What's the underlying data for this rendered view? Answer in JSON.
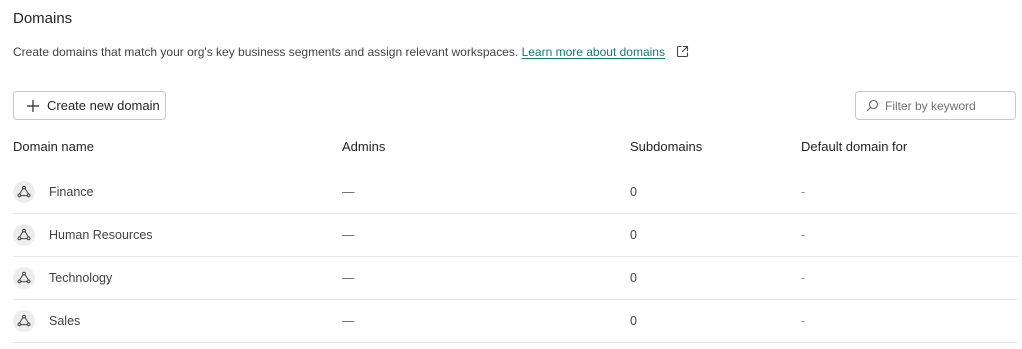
{
  "page": {
    "title": "Domains",
    "description": "Create domains that match your org's key business segments and assign relevant workspaces.",
    "learn_more_link": "Learn more about domains",
    "external_link_icon": "external-link-icon"
  },
  "toolbar": {
    "create_label": "Create new domain",
    "create_icon": "plus-icon",
    "filter_placeholder": "Filter by keyword",
    "filter_value": "",
    "filter_icon": "search-icon"
  },
  "table": {
    "headers": {
      "name": "Domain name",
      "admins": "Admins",
      "subdomains": "Subdomains",
      "default_for": "Default domain for"
    },
    "rows": [
      {
        "name": "Finance",
        "admins": "—",
        "subdomains": "0",
        "default_for": "-",
        "icon": "domain-icon"
      },
      {
        "name": "Human Resources",
        "admins": "—",
        "subdomains": "0",
        "default_for": "-",
        "icon": "domain-icon"
      },
      {
        "name": "Technology",
        "admins": "—",
        "subdomains": "0",
        "default_for": "-",
        "icon": "domain-icon"
      },
      {
        "name": "Sales",
        "admins": "—",
        "subdomains": "0",
        "default_for": "-",
        "icon": "domain-icon"
      }
    ]
  },
  "colors": {
    "link": "#0f7c6e",
    "border": "#c8c8c8",
    "row_divider": "#e6e6e6",
    "icon_bg": "#ededed"
  }
}
